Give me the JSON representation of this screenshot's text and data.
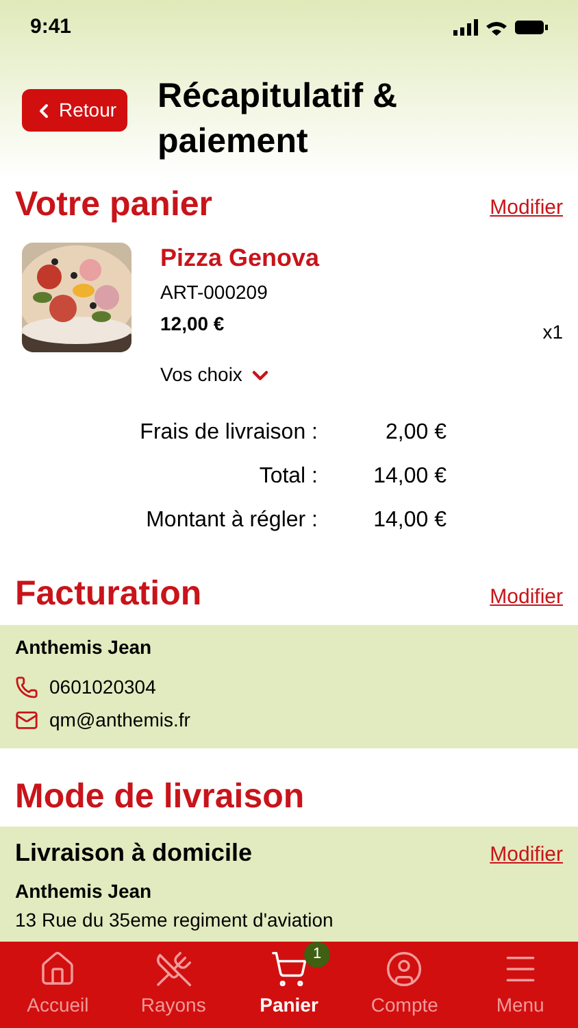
{
  "status_bar": {
    "time": "9:41"
  },
  "header": {
    "back_button": "Retour",
    "title": "Récapitulatif & paiement"
  },
  "cart": {
    "heading": "Votre panier",
    "edit_link": "Modifier",
    "items": [
      {
        "kind": "picture",
        "name": "Pizza Genova",
        "reference": "ART-000209",
        "price": "12,00 €",
        "quantity": "x1",
        "options_label": "Vos choix",
        "expanded": false
      }
    ],
    "totals": [
      {
        "label": "Frais de livraison :",
        "value": "2,00 €"
      },
      {
        "label": "Total :",
        "value": "14,00 €"
      },
      {
        "label": "Montant à régler :",
        "value": "14,00 €"
      }
    ]
  },
  "billing": {
    "heading": "Facturation",
    "edit_link": "Modifier",
    "name": "Anthemis Jean",
    "phone": "0601020304",
    "email": "qm@anthemis.fr"
  },
  "delivery": {
    "heading": "Mode de livraison",
    "method": "Livraison à domicile",
    "edit_link": "Modifier",
    "name": "Anthemis Jean",
    "address": "13 Rue du 35eme regiment d'aviation"
  },
  "tab_bar": [
    {
      "label": "Accueil",
      "selected": false
    },
    {
      "label": "Rayons",
      "selected": false
    },
    {
      "label": "Panier",
      "selected": true,
      "badge": "1"
    },
    {
      "label": "Compte",
      "selected": false
    },
    {
      "label": "Menu",
      "selected": false
    }
  ]
}
